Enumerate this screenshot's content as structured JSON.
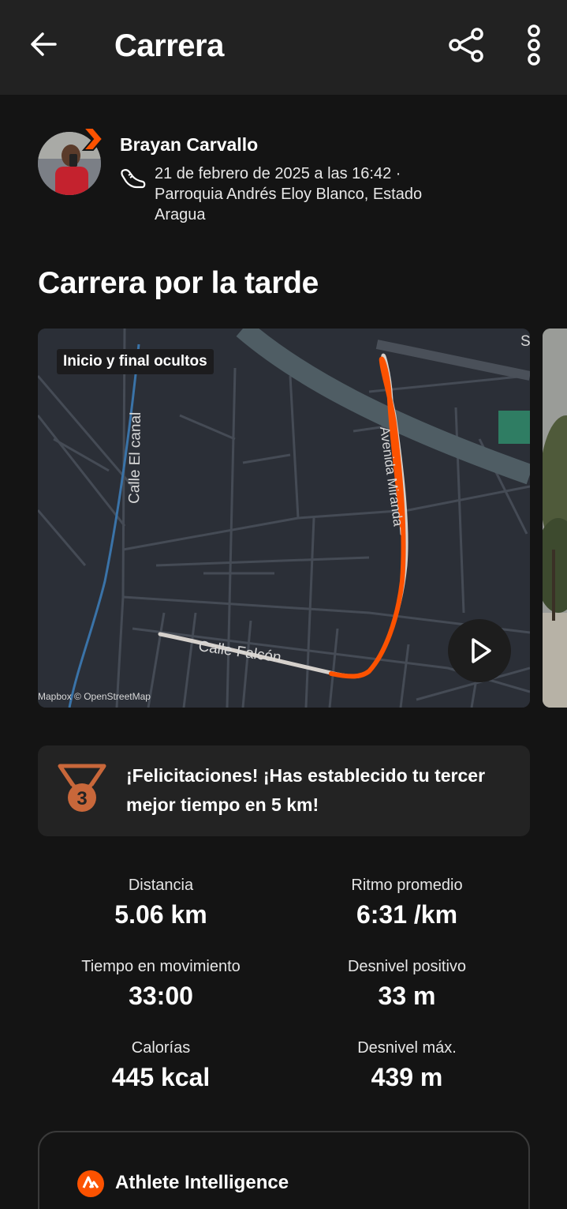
{
  "header": {
    "title": "Carrera",
    "back_icon": "arrow-left-icon",
    "share_icon": "share-icon",
    "more_icon": "more-vertical-icon"
  },
  "athlete": {
    "name": "Brayan Carvallo",
    "date_line": "21 de febrero de 2025 a las 16:42 ·",
    "location_line1": "Parroquia Andrés Eloy Blanco, Estado",
    "location_line2": "Aragua",
    "activity_icon": "running-shoe-icon"
  },
  "activity": {
    "title": "Carrera por la tarde"
  },
  "map": {
    "privacy_chip": "Inicio y final ocultos",
    "street_1": "Calle El canal",
    "street_2": "Avenida Miranda",
    "street_3": "Calle Falcón",
    "street_4": "S",
    "attribution": "Mapbox © OpenStreetMap",
    "route_color": "#fc5200",
    "play_icon": "play-icon"
  },
  "achievement": {
    "text": "¡Felicitaciones! ¡Has establecido tu tercer mejor tiempo en 5 km!",
    "medal_rank": "3",
    "medal_color": "#c8673a"
  },
  "stats": [
    {
      "label": "Distancia",
      "value": "5.06 km"
    },
    {
      "label": "Ritmo promedio",
      "value": "6:31 /km"
    },
    {
      "label": "Tiempo en movimiento",
      "value": "33:00"
    },
    {
      "label": "Desnivel positivo",
      "value": "33 m"
    },
    {
      "label": "Calorías",
      "value": "445 kcal"
    },
    {
      "label": "Desnivel máx.",
      "value": "439 m"
    }
  ],
  "athlete_intelligence": {
    "title": "Athlete Intelligence",
    "icon": "strava-logo-icon",
    "accent": "#fc5200"
  }
}
